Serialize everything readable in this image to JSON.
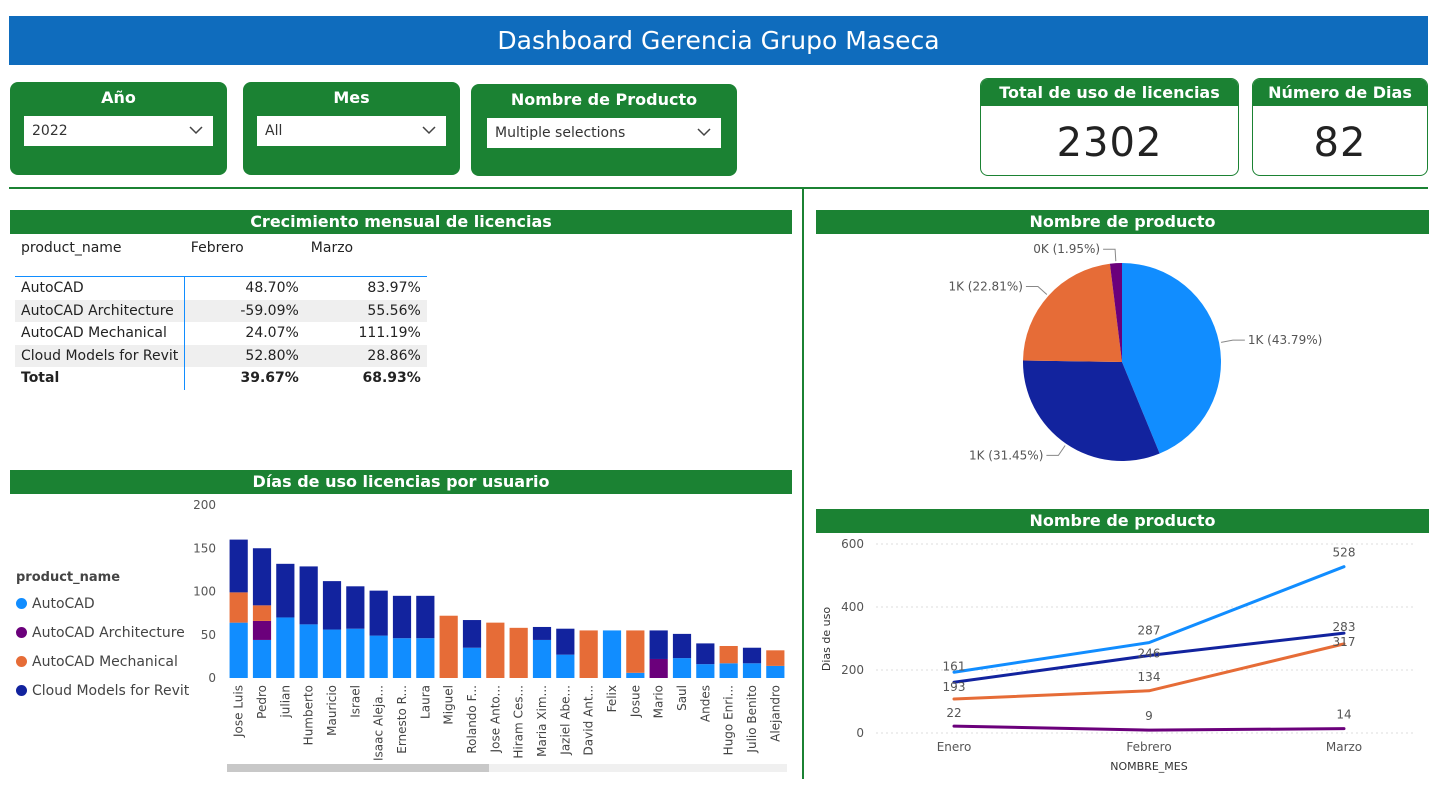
{
  "header": {
    "title": "Dashboard Gerencia Grupo Maseca"
  },
  "slicers": {
    "year": {
      "label": "Año",
      "value": "2022"
    },
    "month": {
      "label": "Mes",
      "value": "All"
    },
    "product": {
      "label": "Nombre de Producto",
      "value": "Multiple selections"
    }
  },
  "cards": {
    "total_licencias": {
      "label": "Total de uso de licencias",
      "value": "2302"
    },
    "numero_dias": {
      "label": "Número de Dias",
      "value": "82"
    }
  },
  "colors": {
    "accent_green": "#1b8233",
    "header_blue": "#0f6cbd",
    "AutoCAD": "#118dff",
    "AutoCAD Architecture": "#6b007b",
    "AutoCAD Mechanical": "#e66c37",
    "Cloud Models for Revit": "#12239e"
  },
  "growth_table": {
    "title": "Crecimiento mensual de licencias",
    "headers": [
      "product_name",
      "Febrero",
      "Marzo"
    ],
    "rows": [
      [
        "AutoCAD",
        "48.70%",
        "83.97%"
      ],
      [
        "AutoCAD Architecture",
        "-59.09%",
        "55.56%"
      ],
      [
        "AutoCAD Mechanical",
        "24.07%",
        "111.19%"
      ],
      [
        "Cloud Models for Revit",
        "52.80%",
        "28.86%"
      ]
    ],
    "total": [
      "Total",
      "39.67%",
      "68.93%"
    ]
  },
  "chart_data": [
    {
      "type": "pie",
      "title": "Nombre de producto",
      "slices": [
        {
          "name": "AutoCAD",
          "percent": 43.79,
          "label": "1K (43.79%)",
          "color": "#118dff"
        },
        {
          "name": "Cloud Models for Revit",
          "percent": 31.45,
          "label": "1K (31.45%)",
          "color": "#12239e"
        },
        {
          "name": "AutoCAD Mechanical",
          "percent": 22.81,
          "label": "1K (22.81%)",
          "color": "#e66c37"
        },
        {
          "name": "AutoCAD Architecture",
          "percent": 1.95,
          "label": "0K (1.95%)",
          "color": "#6b007b"
        }
      ]
    },
    {
      "type": "bar",
      "stacked": true,
      "title": "Días de uso licencias por usuario",
      "legend_title": "product_name",
      "legend_position": "left",
      "ylim": [
        0,
        200
      ],
      "yticks": [
        0,
        50,
        100,
        150,
        200
      ],
      "categories": [
        "Jose Luis",
        "Pedro",
        "julian",
        "Humberto",
        "Mauricio",
        "Israel",
        "Isaac Aleja...",
        "Ernesto R...",
        "Laura",
        "Miguel",
        "Rolando F...",
        "Jose Anto...",
        "Hiram Ces...",
        "Maria Xim...",
        "Jaziel Abe...",
        "David Ant...",
        "Felix",
        "Josue",
        "Mario",
        "Saul",
        "Andes",
        "Hugo Enri...",
        "Julio Benito",
        "Alejandro"
      ],
      "series": [
        {
          "name": "AutoCAD",
          "color": "#118dff",
          "values": [
            64,
            44,
            70,
            62,
            56,
            57,
            49,
            46,
            46,
            0,
            35,
            0,
            0,
            44,
            27,
            0,
            55,
            6,
            0,
            23,
            16,
            17,
            17,
            14
          ]
        },
        {
          "name": "AutoCAD Architecture",
          "color": "#6b007b",
          "values": [
            0,
            22,
            0,
            0,
            0,
            0,
            0,
            0,
            0,
            0,
            0,
            0,
            0,
            0,
            0,
            0,
            0,
            0,
            22,
            0,
            0,
            0,
            0,
            0
          ]
        },
        {
          "name": "AutoCAD Mechanical",
          "color": "#e66c37",
          "values": [
            35,
            18,
            0,
            0,
            0,
            0,
            0,
            0,
            0,
            72,
            0,
            64,
            58,
            0,
            0,
            55,
            0,
            49,
            0,
            0,
            0,
            20,
            0,
            18
          ]
        },
        {
          "name": "Cloud Models for Revit",
          "color": "#12239e",
          "values": [
            61,
            66,
            62,
            67,
            56,
            49,
            52,
            49,
            49,
            0,
            32,
            0,
            0,
            15,
            30,
            0,
            0,
            0,
            33,
            28,
            24,
            0,
            18,
            0
          ]
        }
      ]
    },
    {
      "type": "line",
      "title": "Nombre de producto",
      "xlabel": "NOMBRE_MES",
      "ylabel": "Dias de uso",
      "categories": [
        "Enero",
        "Febrero",
        "Marzo"
      ],
      "ylim": [
        0,
        600
      ],
      "yticks": [
        0,
        200,
        400,
        600
      ],
      "grid": true,
      "series": [
        {
          "name": "AutoCAD",
          "color": "#118dff",
          "values": [
            193,
            287,
            528
          ]
        },
        {
          "name": "Cloud Models for Revit",
          "color": "#12239e",
          "values": [
            161,
            246,
            317
          ]
        },
        {
          "name": "AutoCAD Mechanical",
          "color": "#e66c37",
          "values": [
            108,
            134,
            283
          ]
        },
        {
          "name": "AutoCAD Architecture",
          "color": "#6b007b",
          "values": [
            22,
            9,
            14
          ]
        }
      ],
      "data_labels": {
        "Enero": [
          "161",
          "193",
          "22"
        ],
        "Febrero": [
          "287",
          "246",
          "134",
          "9"
        ],
        "Marzo": [
          "528",
          "283",
          "317",
          "14"
        ]
      }
    }
  ]
}
